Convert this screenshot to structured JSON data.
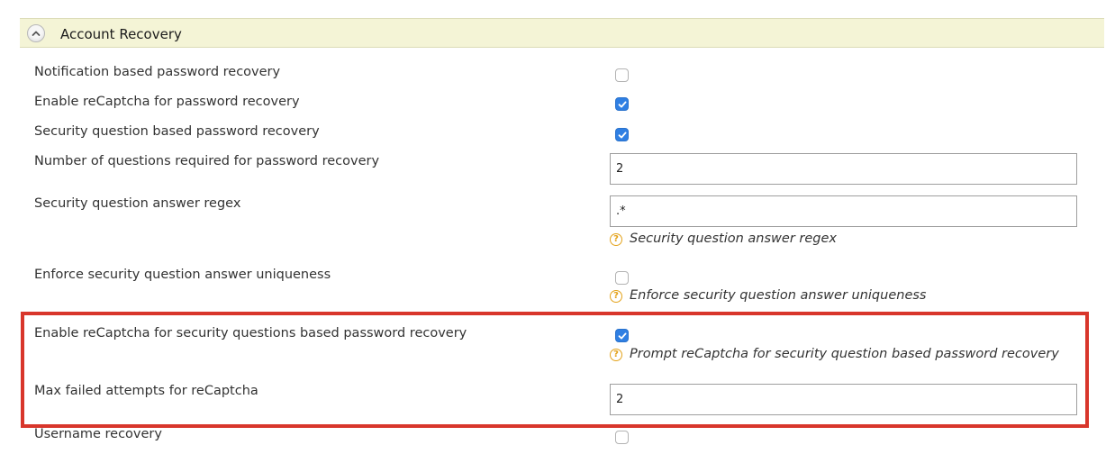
{
  "section": {
    "title": "Account Recovery"
  },
  "fields": {
    "notification_recovery": {
      "label": "Notification based password recovery",
      "checked": false
    },
    "recaptcha_password_recovery": {
      "label": "Enable reCaptcha for password recovery",
      "checked": true
    },
    "security_question_recovery": {
      "label": "Security question based password recovery",
      "checked": true
    },
    "num_questions": {
      "label": "Number of questions required for password recovery",
      "value": "2"
    },
    "answer_regex": {
      "label": "Security question answer regex",
      "value": ".*",
      "help": "Security question answer regex"
    },
    "answer_uniqueness": {
      "label": "Enforce security question answer uniqueness",
      "checked": false,
      "help": "Enforce security question answer uniqueness"
    },
    "recaptcha_security_questions": {
      "label": "Enable reCaptcha for security questions based password recovery",
      "checked": true,
      "help": "Prompt reCaptcha for security question based password recovery"
    },
    "max_failed_attempts": {
      "label": "Max failed attempts for reCaptcha",
      "value": "2"
    },
    "username_recovery": {
      "label": "Username recovery",
      "checked": false
    }
  },
  "colors": {
    "header_bg": "#f4f4d6",
    "checkbox_checked": "#2f7fe3",
    "help_icon": "#e3a21a",
    "highlight_border": "#d8362b"
  },
  "icons": {
    "collapse": "chevron-up-icon",
    "help": "question-circle-icon",
    "check": "check-icon"
  }
}
